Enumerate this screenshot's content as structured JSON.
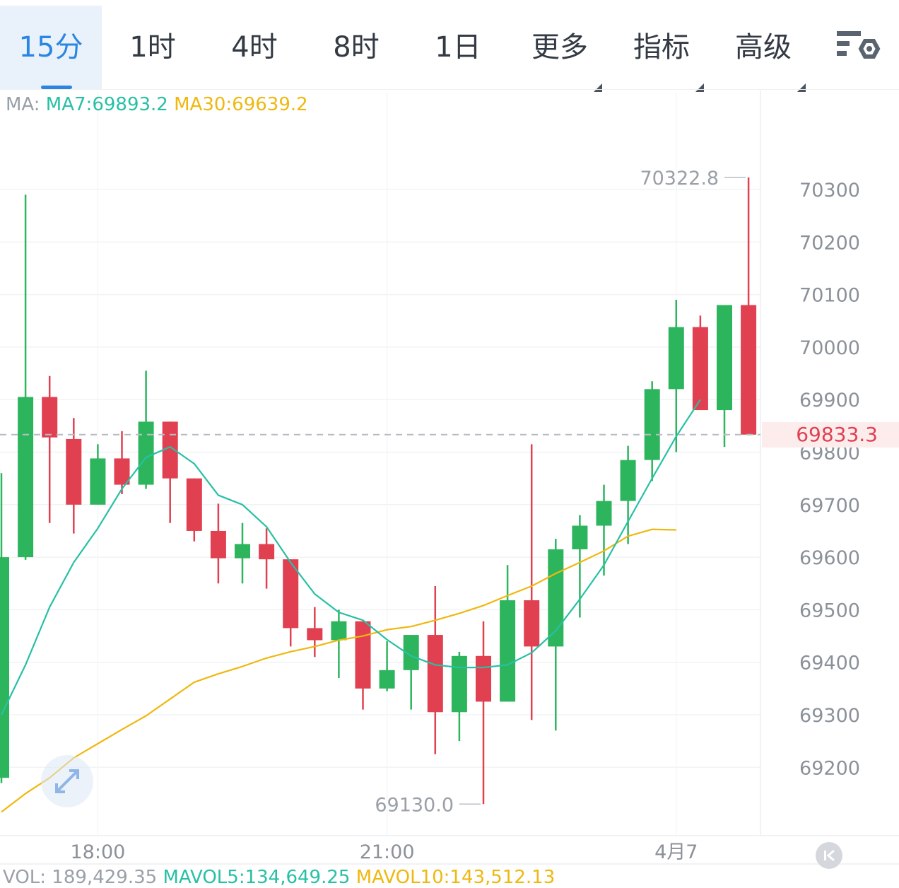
{
  "tabs": [
    {
      "label": "15分",
      "active": true,
      "dropdown": false
    },
    {
      "label": "1时",
      "active": false,
      "dropdown": false
    },
    {
      "label": "4时",
      "active": false,
      "dropdown": false
    },
    {
      "label": "8时",
      "active": false,
      "dropdown": false
    },
    {
      "label": "1日",
      "active": false,
      "dropdown": false
    },
    {
      "label": "更多",
      "active": false,
      "dropdown": true
    },
    {
      "label": "指标",
      "active": false,
      "dropdown": true
    },
    {
      "label": "高级",
      "active": false,
      "dropdown": true
    }
  ],
  "ma_legend": {
    "label": "MA:",
    "ma7": "MA7:69893.2",
    "ma30": "MA30:69639.2"
  },
  "vol_legend": {
    "label": "VOL: 189,429.35",
    "mavol5": "MAVOL5:134,649.25",
    "mavol10": "MAVOL10:143,512.13"
  },
  "last_price": "69833.3",
  "colors": {
    "up": "#2db55d",
    "down": "#e04050",
    "ma7": "#27c0a5",
    "ma30": "#efb80e",
    "accent": "#2a86e0"
  },
  "icons": {
    "settings": "chart-settings-icon",
    "expand": "expand-arrows-icon",
    "back": "back-to-latest-icon"
  },
  "chart_data": {
    "type": "candlestick",
    "interval": "15分",
    "ylim": [
      69080,
      70370
    ],
    "yticks": [
      70300,
      70200,
      70100,
      70000,
      69900,
      69800,
      69700,
      69600,
      69500,
      69400,
      69300,
      69200
    ],
    "xticks": [
      "18:00",
      "21:00",
      "4月7"
    ],
    "xtick_candle_index": [
      4,
      16,
      28
    ],
    "high_label": "70322.8",
    "low_label": "69130.0",
    "last_price": 69833.3,
    "candles": [
      {
        "o": 69180,
        "h": 69760,
        "l": 69170,
        "c": 69600
      },
      {
        "o": 69600,
        "h": 70290,
        "l": 69595,
        "c": 69905
      },
      {
        "o": 69905,
        "h": 69945,
        "l": 69665,
        "c": 69828
      },
      {
        "o": 69825,
        "h": 69865,
        "l": 69645,
        "c": 69700
      },
      {
        "o": 69700,
        "h": 69815,
        "l": 69700,
        "c": 69788
      },
      {
        "o": 69788,
        "h": 69840,
        "l": 69720,
        "c": 69738
      },
      {
        "o": 69738,
        "h": 69955,
        "l": 69730,
        "c": 69858
      },
      {
        "o": 69858,
        "h": 69858,
        "l": 69665,
        "c": 69750
      },
      {
        "o": 69750,
        "h": 69750,
        "l": 69630,
        "c": 69650
      },
      {
        "o": 69650,
        "h": 69702,
        "l": 69550,
        "c": 69598
      },
      {
        "o": 69598,
        "h": 69665,
        "l": 69550,
        "c": 69625
      },
      {
        "o": 69625,
        "h": 69655,
        "l": 69540,
        "c": 69596
      },
      {
        "o": 69596,
        "h": 69596,
        "l": 69430,
        "c": 69465
      },
      {
        "o": 69465,
        "h": 69505,
        "l": 69410,
        "c": 69442
      },
      {
        "o": 69442,
        "h": 69500,
        "l": 69370,
        "c": 69478
      },
      {
        "o": 69478,
        "h": 69478,
        "l": 69310,
        "c": 69350
      },
      {
        "o": 69350,
        "h": 69440,
        "l": 69345,
        "c": 69385
      },
      {
        "o": 69385,
        "h": 69440,
        "l": 69310,
        "c": 69452
      },
      {
        "o": 69452,
        "h": 69545,
        "l": 69225,
        "c": 69305
      },
      {
        "o": 69305,
        "h": 69420,
        "l": 69250,
        "c": 69412
      },
      {
        "o": 69412,
        "h": 69478,
        "l": 69130,
        "c": 69325
      },
      {
        "o": 69325,
        "h": 69585,
        "l": 69325,
        "c": 69518
      },
      {
        "o": 69518,
        "h": 69815,
        "l": 69290,
        "c": 69430
      },
      {
        "o": 69430,
        "h": 69635,
        "l": 69270,
        "c": 69615
      },
      {
        "o": 69615,
        "h": 69680,
        "l": 69485,
        "c": 69660
      },
      {
        "o": 69660,
        "h": 69738,
        "l": 69565,
        "c": 69707
      },
      {
        "o": 69707,
        "h": 69812,
        "l": 69625,
        "c": 69785
      },
      {
        "o": 69785,
        "h": 69935,
        "l": 69745,
        "c": 69920
      },
      {
        "o": 69920,
        "h": 70090,
        "l": 69800,
        "c": 70038
      },
      {
        "o": 70038,
        "h": 70060,
        "l": 69880,
        "c": 69880
      },
      {
        "o": 69880,
        "h": 70080,
        "l": 69810,
        "c": 70080
      },
      {
        "o": 70080,
        "h": 70322.8,
        "l": 69833.3,
        "c": 69833.3
      }
    ],
    "ma7": [
      69300,
      69395,
      69505,
      69590,
      69655,
      69730,
      69790,
      69810,
      69778,
      69718,
      69700,
      69658,
      69590,
      69530,
      69495,
      69480,
      69443,
      69412,
      69395,
      69390,
      69390,
      69395,
      69418,
      69460,
      69520,
      69585,
      69668,
      69750,
      69830,
      69900
    ],
    "ma30": [
      69115,
      69150,
      69180,
      69218,
      69245,
      69272,
      69298,
      69330,
      69362,
      69378,
      69392,
      69408,
      69420,
      69430,
      69442,
      69450,
      69462,
      69468,
      69480,
      69493,
      69508,
      69527,
      69545,
      69569,
      69590,
      69612,
      69640,
      69653,
      69652
    ]
  }
}
